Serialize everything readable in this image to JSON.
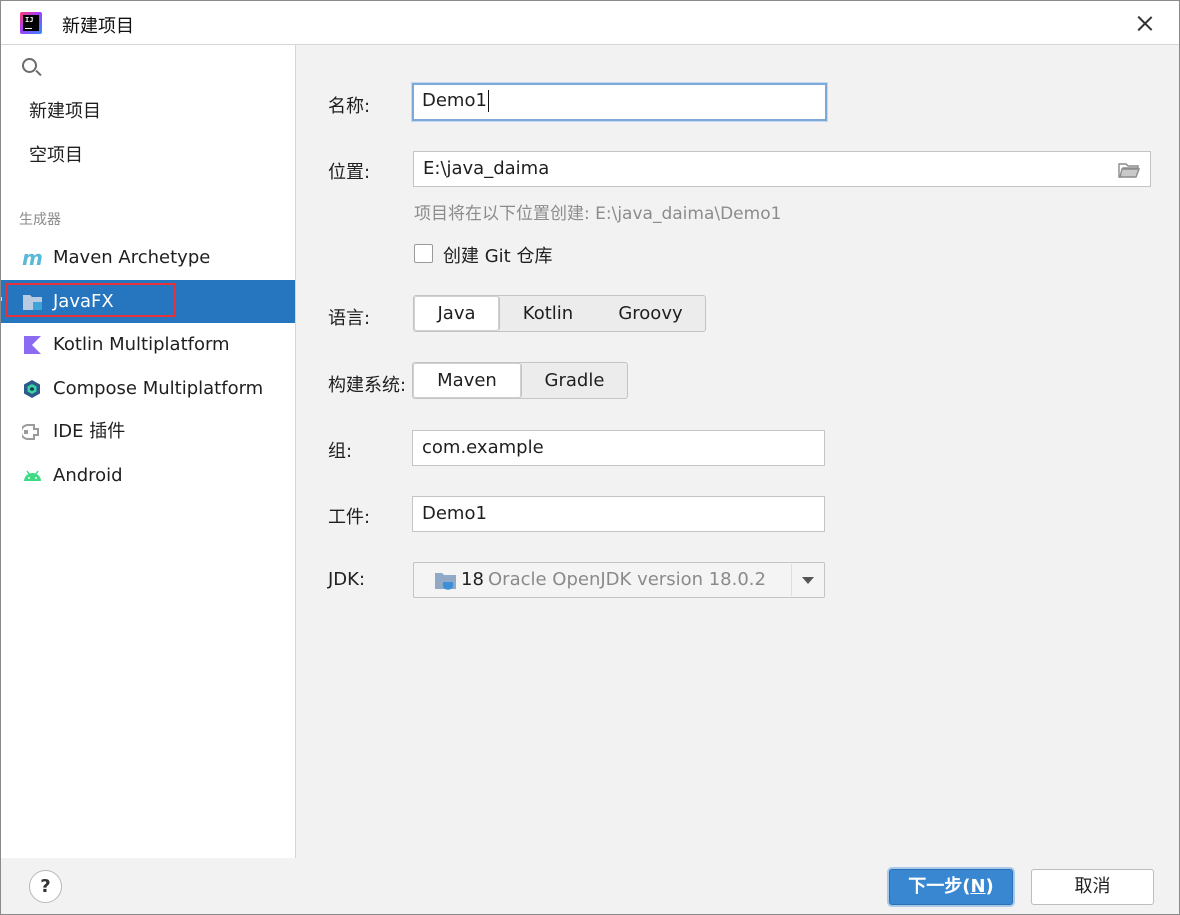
{
  "window": {
    "title": "新建项目"
  },
  "sidebar": {
    "search": {
      "placeholder": ""
    },
    "top_items": [
      {
        "label": "新建项目"
      },
      {
        "label": "空项目"
      }
    ],
    "group_label": "生成器",
    "generators": [
      {
        "label": "Maven Archetype",
        "icon": "maven-icon"
      },
      {
        "label": "JavaFX",
        "icon": "javafx-icon",
        "selected": true
      },
      {
        "label": "Kotlin Multiplatform",
        "icon": "kotlin-icon"
      },
      {
        "label": "Compose Multiplatform",
        "icon": "compose-icon"
      },
      {
        "label": "IDE 插件",
        "icon": "plugin-icon"
      },
      {
        "label": "Android",
        "icon": "android-icon"
      }
    ]
  },
  "form": {
    "name": {
      "label": "名称:",
      "value": "Demo1"
    },
    "location": {
      "label": "位置:",
      "value": "E:\\java_daima",
      "hint": "项目将在以下位置创建: E:\\java_daima\\Demo1"
    },
    "git": {
      "label": "创建 Git 仓库",
      "checked": false
    },
    "language": {
      "label": "语言:",
      "options": [
        "Java",
        "Kotlin",
        "Groovy"
      ],
      "selected": "Java"
    },
    "build_system": {
      "label": "构建系统:",
      "options": [
        "Maven",
        "Gradle"
      ],
      "selected": "Maven"
    },
    "group": {
      "label": "组:",
      "value": "com.example"
    },
    "artifact": {
      "label": "工件:",
      "value": "Demo1"
    },
    "jdk": {
      "label": "JDK:",
      "version": "18",
      "description": "Oracle OpenJDK version 18.0.2"
    }
  },
  "footer": {
    "help": "?",
    "next_label": "下一步(",
    "next_mnemonic": "N",
    "next_suffix": ")",
    "cancel_label": "取消"
  },
  "colors": {
    "accent": "#2675bf",
    "primary_button": "#3a87d1",
    "highlight": "#e5323a"
  }
}
